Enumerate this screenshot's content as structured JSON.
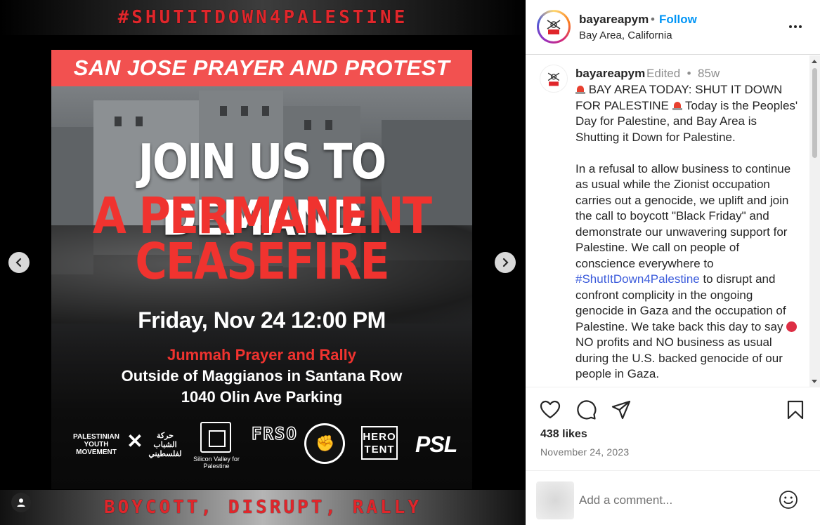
{
  "media": {
    "top_banner": "#SHUTITDOWN4PALESTINE",
    "bottom_banner": "BOYCOTT, DISRUPT, RALLY",
    "poster": {
      "banner": "SAN JOSE PRAYER AND PROTEST",
      "headline_1": "JOIN US TO DEMAND",
      "headline_2": "A PERMANENT",
      "headline_3": "CEASEFIRE",
      "date_time": "Friday, Nov 24 12:00 PM",
      "event": "Jummah Prayer and Rally",
      "location": "Outside of Maggianos in Santana Row",
      "address": "1040 Olin Ave Parking",
      "logos": {
        "pym": "PALESTINIAN YOUTH MOVEMENT",
        "pym_arabic": "حركة الشباب لفلسطيني",
        "sv": "Silicon Valley for Palestine",
        "frso": "FRSO",
        "hero": "HERO TENT",
        "psl": "PSL"
      }
    },
    "icons": {
      "prev": "chevron-left-icon",
      "next": "chevron-right-icon",
      "tag": "user-icon"
    }
  },
  "header": {
    "username": "bayareapym",
    "dot": "•",
    "follow": "Follow",
    "location": "Bay Area, California"
  },
  "caption": {
    "username": "bayareapym",
    "meta": "Edited  •  85w",
    "p1_a": " BAY AREA TODAY: SHUT IT DOWN FOR PALESTINE ",
    "p1_b": " Today is the Peoples' Day for Palestine, and Bay Area is Shutting it Down for Palestine.",
    "p2_a": "In a refusal to allow business to continue as usual while the Zionist occupation carries out a genocide, we uplift and join the call to boycott \"Black Friday\" and demonstrate our unwavering support for Palestine. We call on people of conscience everywhere to ",
    "hashtag": "#ShutItDown4Palestine",
    "p2_b": " to disrupt and confront complicity in the ongoing genocide in Gaza and the occupation of Palestine. We take back this day to say ",
    "p2_c": " NO profits and NO business as usual during the U.S. backed genocide of our people in Gaza."
  },
  "actions": {
    "like_icon": "heart-icon",
    "comment_icon": "comment-icon",
    "share_icon": "send-icon",
    "save_icon": "bookmark-icon"
  },
  "likes": "438 likes",
  "date": "November 24, 2023",
  "comment": {
    "placeholder": "Add a comment...",
    "emoji_icon": "smiley-icon"
  },
  "colors": {
    "accent": "#0095f6",
    "hashtag": "#3b5bdb",
    "poster_red": "#f0332f",
    "banner_red": "#e0262b"
  }
}
